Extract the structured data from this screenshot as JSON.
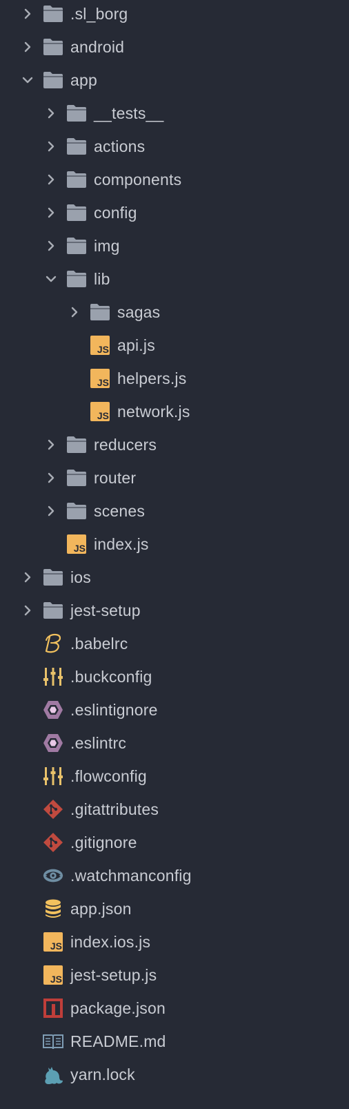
{
  "colors": {
    "background": "#262a35",
    "text": "#c9ccd3",
    "folder": "#9aa1ad",
    "chevron": "#a9adb5",
    "js_badge": "#f2b65c",
    "js_text": "#262a35",
    "babel": "#f2c15e",
    "buck": "#e8c16a",
    "eslint": "#a07aa3",
    "git": "#c04a3f",
    "watchman": "#6f8ea3",
    "json": "#f2c15e",
    "npm": "#bf3e3a",
    "readme": "#7f9db5",
    "yarn": "#5c9fb3"
  },
  "tree": [
    {
      "label": ".sl_borg",
      "type": "folder",
      "depth": 0,
      "state": "collapsed"
    },
    {
      "label": "android",
      "type": "folder",
      "depth": 0,
      "state": "collapsed"
    },
    {
      "label": "app",
      "type": "folder",
      "depth": 0,
      "state": "expanded"
    },
    {
      "label": "__tests__",
      "type": "folder",
      "depth": 1,
      "state": "collapsed"
    },
    {
      "label": "actions",
      "type": "folder",
      "depth": 1,
      "state": "collapsed"
    },
    {
      "label": "components",
      "type": "folder",
      "depth": 1,
      "state": "collapsed"
    },
    {
      "label": "config",
      "type": "folder",
      "depth": 1,
      "state": "collapsed"
    },
    {
      "label": "img",
      "type": "folder",
      "depth": 1,
      "state": "collapsed"
    },
    {
      "label": "lib",
      "type": "folder",
      "depth": 1,
      "state": "expanded"
    },
    {
      "label": "sagas",
      "type": "folder",
      "depth": 2,
      "state": "collapsed"
    },
    {
      "label": "api.js",
      "type": "js",
      "depth": 2
    },
    {
      "label": "helpers.js",
      "type": "js",
      "depth": 2
    },
    {
      "label": "network.js",
      "type": "js",
      "depth": 2
    },
    {
      "label": "reducers",
      "type": "folder",
      "depth": 1,
      "state": "collapsed"
    },
    {
      "label": "router",
      "type": "folder",
      "depth": 1,
      "state": "collapsed"
    },
    {
      "label": "scenes",
      "type": "folder",
      "depth": 1,
      "state": "collapsed"
    },
    {
      "label": "index.js",
      "type": "js",
      "depth": 1
    },
    {
      "label": "ios",
      "type": "folder",
      "depth": 0,
      "state": "collapsed"
    },
    {
      "label": "jest-setup",
      "type": "folder",
      "depth": 0,
      "state": "collapsed"
    },
    {
      "label": ".babelrc",
      "type": "babel",
      "depth": 0
    },
    {
      "label": ".buckconfig",
      "type": "buck",
      "depth": 0
    },
    {
      "label": ".eslintignore",
      "type": "eslint",
      "depth": 0
    },
    {
      "label": ".eslintrc",
      "type": "eslint",
      "depth": 0
    },
    {
      "label": ".flowconfig",
      "type": "buck",
      "depth": 0
    },
    {
      "label": ".gitattributes",
      "type": "git",
      "depth": 0
    },
    {
      "label": ".gitignore",
      "type": "git",
      "depth": 0
    },
    {
      "label": ".watchmanconfig",
      "type": "watchman",
      "depth": 0
    },
    {
      "label": "app.json",
      "type": "json",
      "depth": 0
    },
    {
      "label": "index.ios.js",
      "type": "js",
      "depth": 0
    },
    {
      "label": "jest-setup.js",
      "type": "js",
      "depth": 0
    },
    {
      "label": "package.json",
      "type": "npm",
      "depth": 0
    },
    {
      "label": "README.md",
      "type": "readme",
      "depth": 0
    },
    {
      "label": "yarn.lock",
      "type": "yarn",
      "depth": 0
    }
  ]
}
